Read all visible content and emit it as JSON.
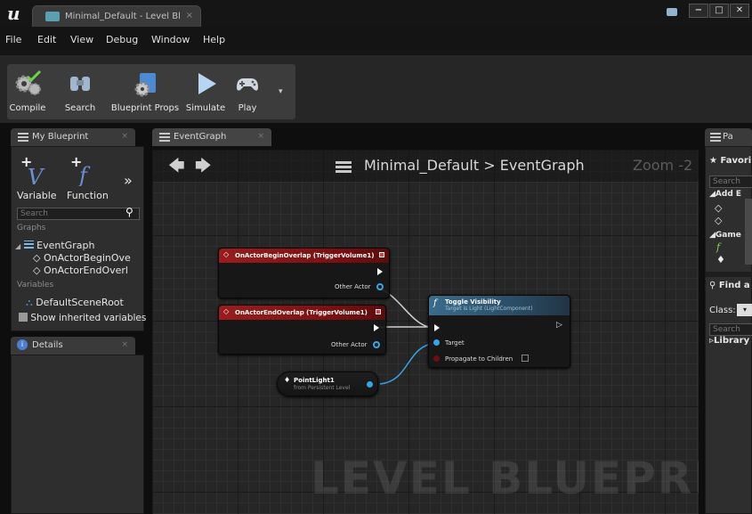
{
  "window": {
    "logo": "u",
    "tab_title": "Minimal_Default - Level Bl",
    "tab_close": "×",
    "buttons": {
      "minimize": "−",
      "maximize": "□",
      "close": "✕"
    }
  },
  "menu": [
    "File",
    "Edit",
    "View",
    "Debug",
    "Window",
    "Help"
  ],
  "toolbar": {
    "compile": "Compile",
    "search": "Search",
    "blueprint_props": "Blueprint Props",
    "simulate": "Simulate",
    "play": "Play"
  },
  "my_blueprint": {
    "tab": "My Blueprint",
    "variable_btn": "Variable",
    "function_btn": "Function",
    "more": "»",
    "search_placeholder": "Search",
    "graphs_label": "Graphs",
    "event_graph": "EventGraph",
    "event1": "OnActorBeginOve",
    "event2": "OnActorEndOverl",
    "variables_label": "Variables",
    "variable1": "DefaultSceneRoot",
    "show_inherited": "Show inherited variables"
  },
  "details": {
    "tab": "Details"
  },
  "graph": {
    "tab": "EventGraph",
    "breadcrumb_root": "Minimal_Default",
    "breadcrumb_sep": ">",
    "breadcrumb_leaf": "EventGraph",
    "zoom": "Zoom -2",
    "watermark": "LEVEL BLUEPRINT"
  },
  "nodes": {
    "begin_overlap": {
      "title": "OnActorBeginOverlap (TriggerVolume1)",
      "pin": "Other Actor"
    },
    "end_overlap": {
      "title": "OnActorEndOverlap (TriggerVolume1)",
      "pin": "Other Actor"
    },
    "toggle": {
      "title": "Toggle Visibility",
      "subtitle": "Target is Light (LightComponent)",
      "target": "Target",
      "propagate": "Propagate to Children"
    },
    "point_light": {
      "title": "PointLight1",
      "subtitle": "from Persistent Level"
    }
  },
  "palette": {
    "tab": "Pa",
    "favorites": "Favori",
    "search_placeholder": "Search",
    "add_event": "Add E",
    "game": "Game",
    "find": "Find a",
    "class_label": "Class:",
    "search2_placeholder": "Search",
    "library": "Library"
  },
  "colors": {
    "event_node": "#9a1d1d",
    "function_node": "#3b6c8c",
    "object_pin": "#34a6e8",
    "background": "#262626"
  }
}
